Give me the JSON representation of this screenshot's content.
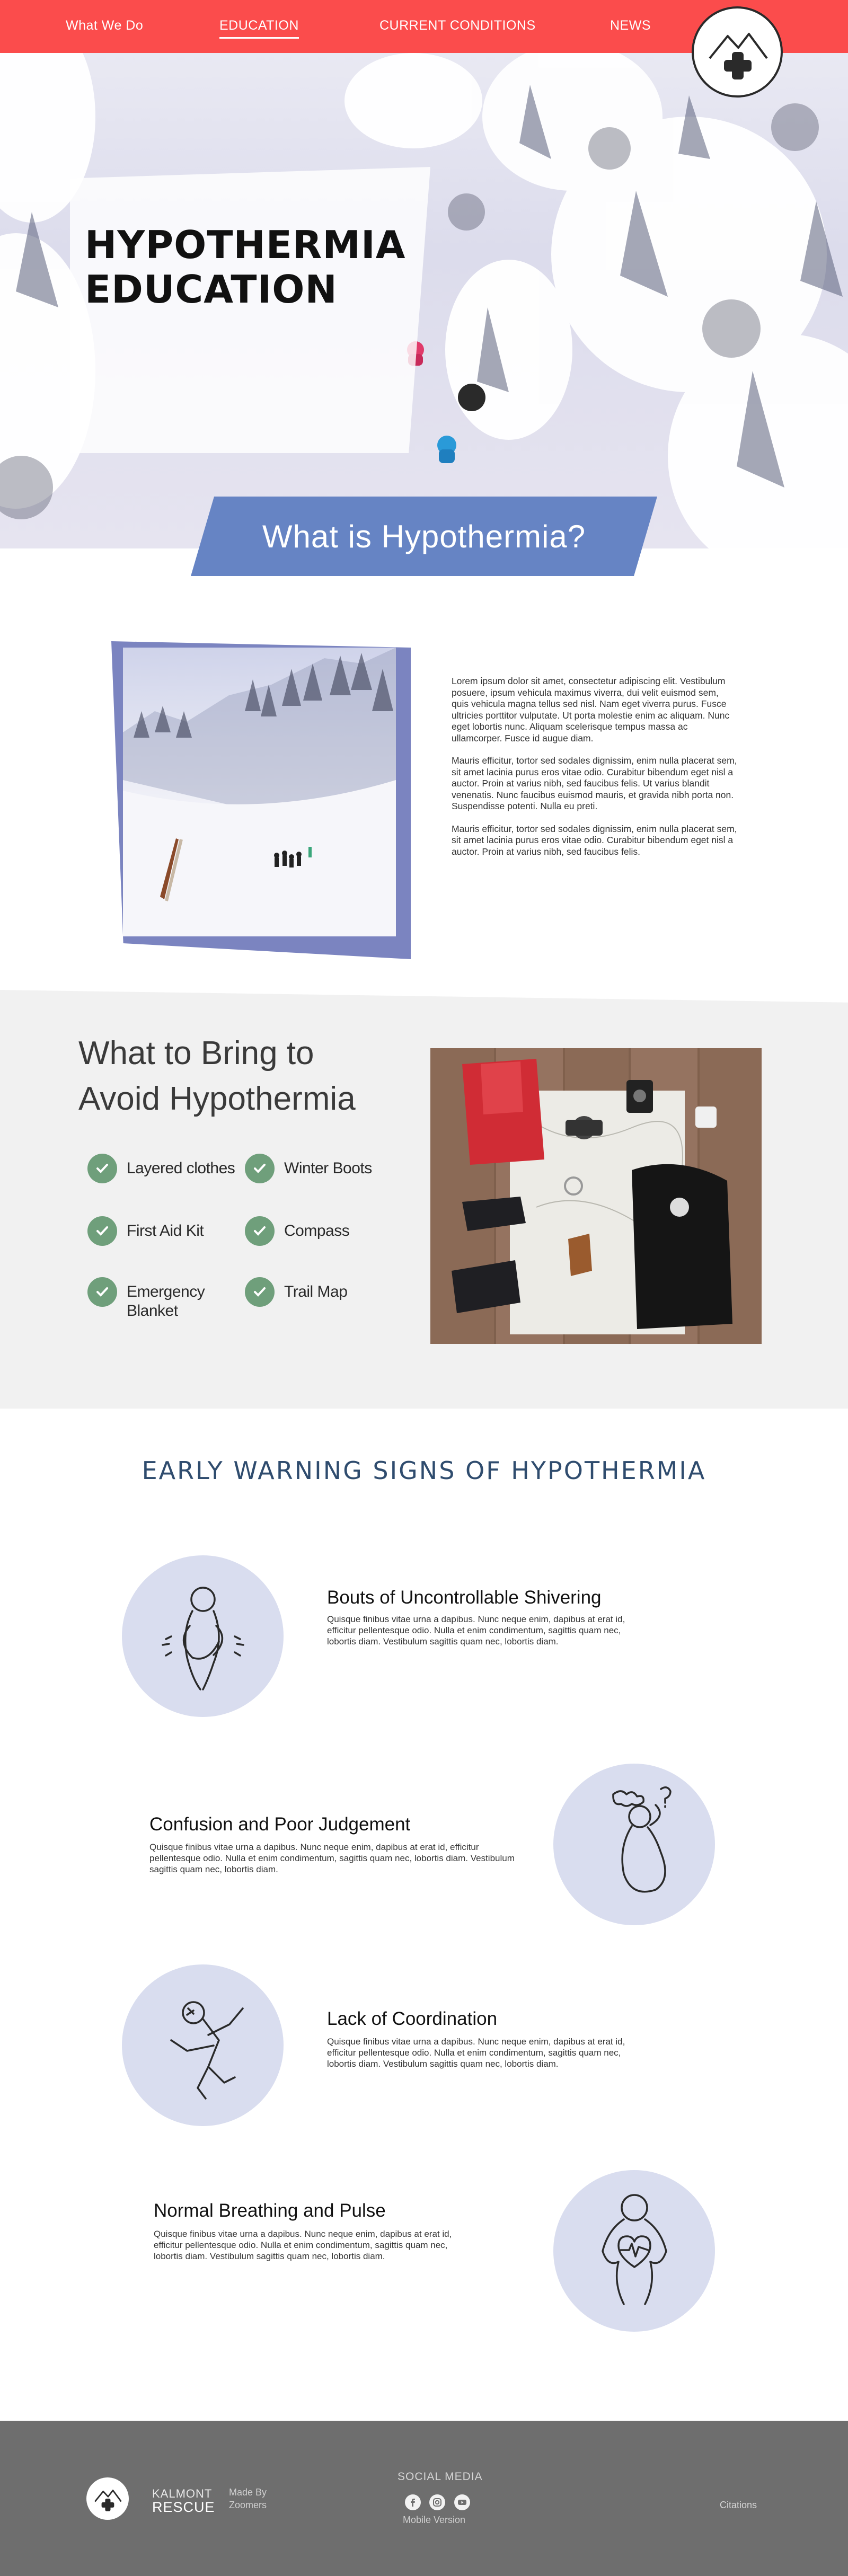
{
  "nav": {
    "items": [
      {
        "label": "What We Do"
      },
      {
        "label": "EDUCATION"
      },
      {
        "label": "CURRENT CONDITIONS"
      },
      {
        "label": "NEWS"
      }
    ],
    "active": "EDUCATION"
  },
  "hero": {
    "title_line1": "HYPOTHERMIA",
    "title_line2": "EDUCATION",
    "banner": "What is Hypothermia?"
  },
  "intro": {
    "paragraphs": [
      "Lorem ipsum dolor sit amet, consectetur adipiscing elit. Vestibulum posuere, ipsum vehicula maximus viverra, dui velit euismod sem, quis vehicula magna tellus sed nisl. Nam eget viverra purus. Fusce ultricies porttitor vulputate. Ut porta molestie enim ac aliquam. Nunc eget lobortis nunc. Aliquam scelerisque tempus massa ac ullamcorper. Fusce id augue diam.",
      "Mauris efficitur, tortor sed sodales dignissim, enim nulla placerat sem, sit amet lacinia purus eros vitae odio. Curabitur bibendum eget nisl a auctor. Proin at varius nibh, sed faucibus felis. Ut varius blandit venenatis. Nunc faucibus euismod mauris, et gravida nibh porta non. Suspendisse potenti. Nulla eu preti.",
      "Mauris efficitur, tortor sed sodales dignissim, enim nulla placerat sem, sit amet lacinia purus eros vitae odio. Curabitur bibendum eget nisl a auctor. Proin at varius nibh, sed faucibus felis."
    ]
  },
  "bring": {
    "title_line1": "What to Bring to",
    "title_line2": "Avoid Hypothermia",
    "items": [
      {
        "label": "Layered clothes"
      },
      {
        "label": "Winter Boots"
      },
      {
        "label": "First Aid Kit"
      },
      {
        "label": "Compass"
      },
      {
        "label": "Emergency Blanket"
      },
      {
        "label": "Trail Map"
      }
    ]
  },
  "signs": {
    "title": "EARLY WARNING SIGNS OF HYPOTHERMIA",
    "items": [
      {
        "title": "Bouts of Uncontrollable Shivering",
        "desc": "Quisque finibus vitae urna a dapibus. Nunc neque enim, dapibus at erat id, efficitur pellentesque odio. Nulla et enim condimentum, sagittis quam nec, lobortis diam. Vestibulum sagittis quam nec, lobortis diam.",
        "icon": "shivering-person-icon"
      },
      {
        "title": "Confusion and Poor Judgement",
        "desc": "Quisque finibus vitae urna a dapibus. Nunc neque enim, dapibus at erat id, efficitur pellentesque odio. Nulla et enim condimentum, sagittis quam nec, lobortis diam. Vestibulum sagittis quam nec, lobortis diam.",
        "icon": "confused-person-icon"
      },
      {
        "title": "Lack of Coordination",
        "desc": "Quisque finibus vitae urna a dapibus. Nunc neque enim, dapibus at erat id, efficitur pellentesque odio. Nulla et enim condimentum, sagittis quam nec, lobortis diam. Vestibulum sagittis quam nec, lobortis diam.",
        "icon": "stumbling-person-icon"
      },
      {
        "title": "Normal Breathing and Pulse",
        "desc": "Quisque finibus vitae urna a dapibus. Nunc neque enim, dapibus at erat id, efficitur pellentesque odio. Nulla et enim condimentum, sagittis quam nec, lobortis diam. Vestibulum sagittis quam nec, lobortis diam.",
        "icon": "heartbeat-person-icon"
      }
    ]
  },
  "footer": {
    "brand_line1": "KALMONT",
    "brand_line2": "RESCUE",
    "made_by_line1": "Made By",
    "made_by_line2": "Zoomers",
    "social_title": "SOCIAL MEDIA",
    "social_icons": [
      "facebook-icon",
      "instagram-icon",
      "youtube-icon"
    ],
    "mobile_link": "Mobile Version",
    "citations_link": "Citations"
  },
  "colors": {
    "nav": "#fb4c4c",
    "banner": "#6684c4",
    "photo_frame": "#7b84c0",
    "check": "#6f9f7b",
    "sign_circle": "#d9ddef",
    "signs_title": "#2f4c6e",
    "footer": "#6e6e6e"
  }
}
